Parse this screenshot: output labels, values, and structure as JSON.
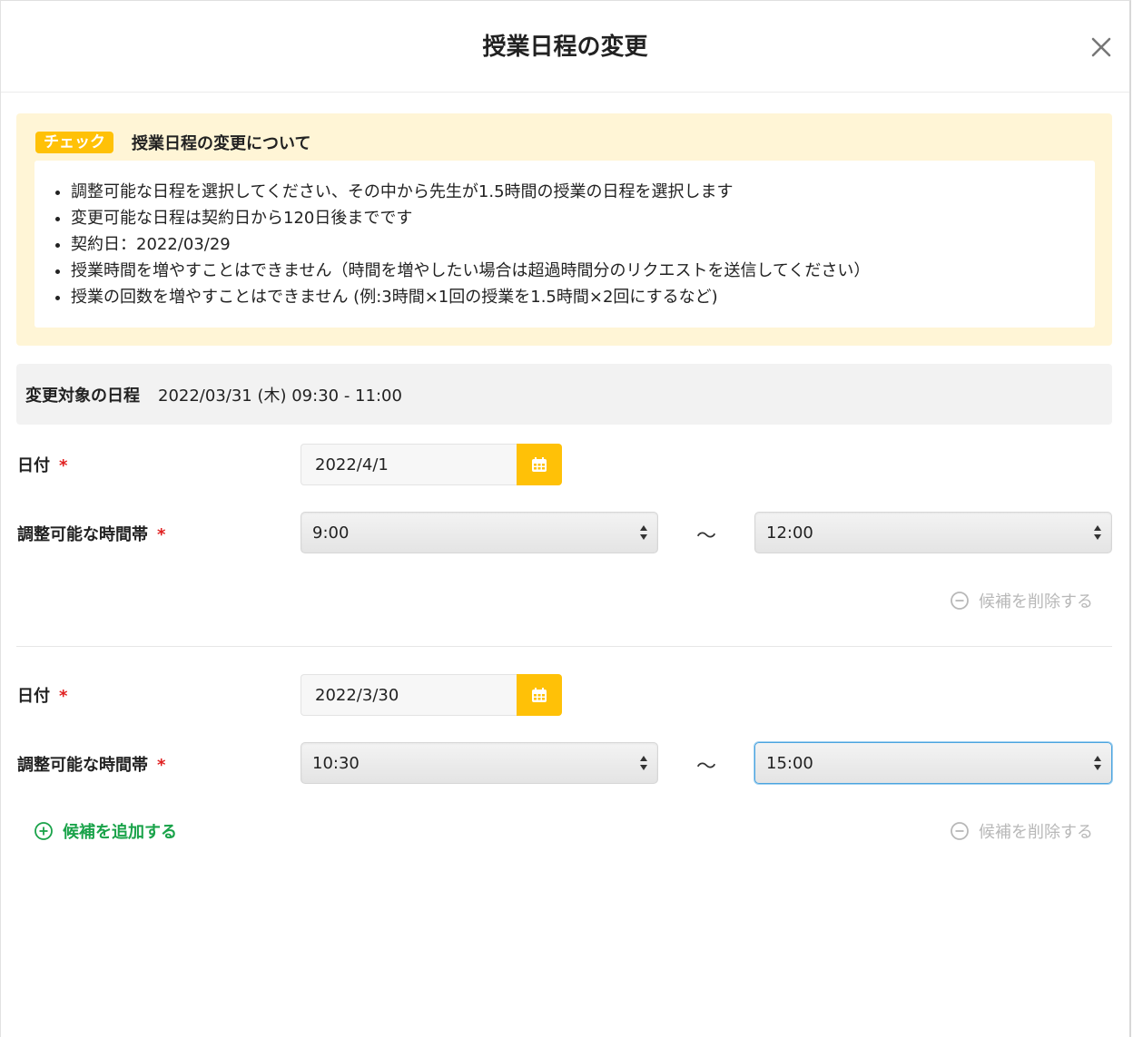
{
  "modal": {
    "title": "授業日程の変更",
    "close_icon": "close-icon"
  },
  "notice": {
    "badge": "チェック",
    "title": "授業日程の変更について",
    "items": [
      "調整可能な日程を選択してください、その中から先生が1.5時間の授業の日程を選択します",
      "変更可能な日程は契約日から120日後までです",
      "契約日：2022/03/29",
      "授業時間を増やすことはできません（時間を増やしたい場合は超過時間分のリクエストを送信してください）",
      "授業の回数を増やすことはできません (例:3時間×1回の授業を1.5時間×2回にするなど)"
    ]
  },
  "target": {
    "label": "変更対象の日程",
    "value": "2022/03/31 (木) 09:30 - 11:00"
  },
  "candidates": [
    {
      "date_label": "日付",
      "required_mark": "*",
      "date_value": "2022/4/1",
      "time_label": "調整可能な時間帯",
      "start_time": "9:00",
      "separator": "〜",
      "end_time": "12:00",
      "remove_label": "候補を削除する"
    },
    {
      "date_label": "日付",
      "required_mark": "*",
      "date_value": "2022/3/30",
      "time_label": "調整可能な時間帯",
      "start_time": "10:30",
      "separator": "〜",
      "end_time": "15:00",
      "remove_label": "候補を削除する"
    }
  ],
  "add_label": "候補を追加する",
  "colors": {
    "accent_yellow": "#ffc107",
    "notice_bg": "#fff5d6",
    "add_green": "#1aa34a",
    "required_red": "#e02020",
    "disabled_gray": "#b8b8b8",
    "focus_blue": "#4aa3df"
  }
}
